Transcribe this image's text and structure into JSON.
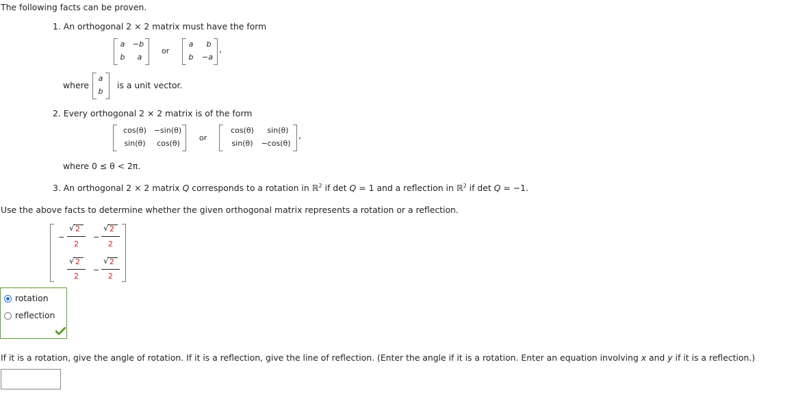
{
  "intro": "The following facts can be proven.",
  "fact1": {
    "label": "1. An orthogonal 2 × 2 matrix must have the form",
    "matrixA": [
      "a",
      "−b",
      "b",
      "a"
    ],
    "or": "or",
    "matrixB": [
      "a",
      "b",
      "b",
      "−a"
    ],
    "comma": ",",
    "where": "where",
    "vector": [
      "a",
      "b"
    ],
    "suffix": "is a unit vector."
  },
  "fact2": {
    "label": "2. Every orthogonal 2 × 2 matrix is of the form",
    "matrixA": [
      "cos(θ)",
      "−sin(θ)",
      "sin(θ)",
      "cos(θ)"
    ],
    "or": "or",
    "matrixB": [
      "cos(θ)",
      "sin(θ)",
      "sin(θ)",
      "−cos(θ)"
    ],
    "comma": ",",
    "where": "where 0 ≤ θ < 2π."
  },
  "fact3": {
    "part1": "3. An orthogonal 2 × 2 matrix ",
    "Q": "Q",
    "part2": " corresponds to a rotation in ℝ",
    "sup": "2",
    "part3": " if det ",
    "part4": " = 1 and a reflection in ℝ",
    "part5": " if det ",
    "part6": " = −1."
  },
  "instruction": "Use the above facts to determine whether the given orthogonal matrix represents a rotation or a reflection.",
  "given_matrix": {
    "cells": [
      {
        "sign": "−",
        "num": "2",
        "den": "2"
      },
      {
        "sign": "−",
        "num": "2",
        "den": "2"
      },
      {
        "sign": "",
        "num": "2",
        "den": "2"
      },
      {
        "sign": "−",
        "num": "2",
        "den": "2"
      }
    ],
    "sqrt_symbol": "√",
    "number_color": "#d42020"
  },
  "options": [
    {
      "label": "rotation",
      "checked": true
    },
    {
      "label": "reflection",
      "checked": false
    }
  ],
  "correct_icon": "checkmark-icon",
  "correct_color": "#5aa02c",
  "question2": {
    "part1": "If it is a rotation, give the angle of rotation. If it is a reflection, give the line of reflection. (Enter the angle if it is a rotation. Enter an equation involving ",
    "x": "x",
    "part2": " and ",
    "y": "y",
    "part3": " if it is a reflection.)"
  },
  "answer_input": {
    "value": "",
    "placeholder": ""
  }
}
